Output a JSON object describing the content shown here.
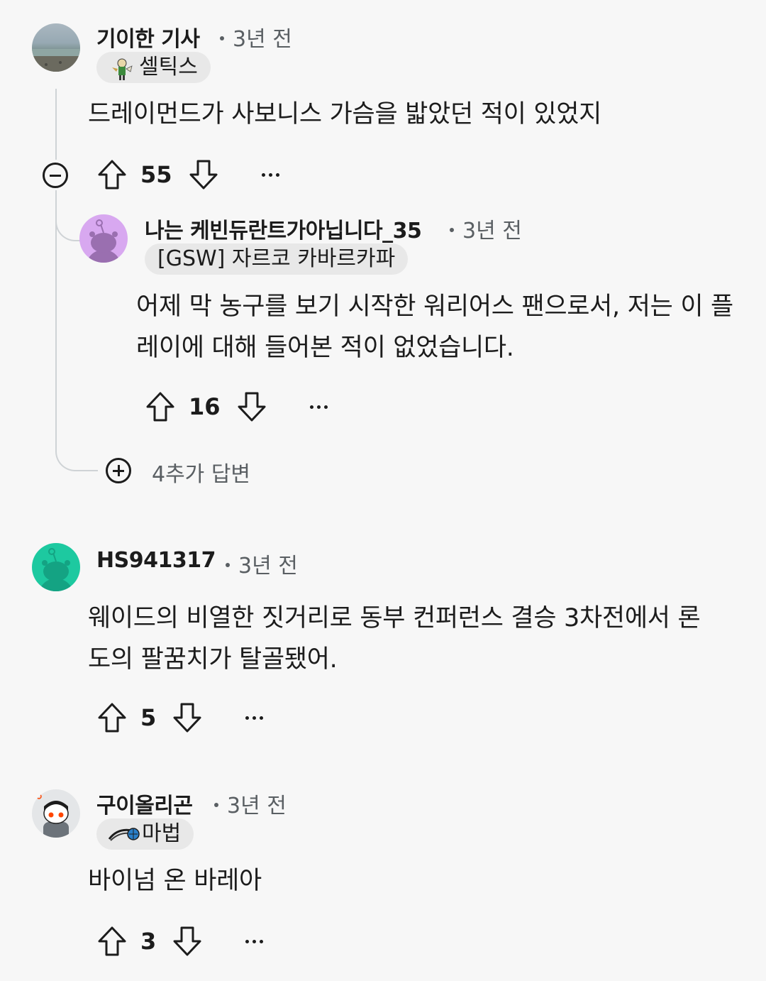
{
  "comments": [
    {
      "username": "기이한 기사",
      "time": "3년 전",
      "flair": "셀틱스",
      "body": "드레이먼드가 사보니스 가슴을 밟았던 적이 있었지",
      "votes": "55"
    },
    {
      "username": "나는 케빈듀란트가아닙니다_35",
      "time": "3년 전",
      "flair": "[GSW] 자르코 카바르카파",
      "body": "어제 막 농구를 보기 시작한 워리어스 팬으로서, 저는 이 플레이에 대해 들어본 적이 없었습니다.",
      "votes": "16"
    },
    {
      "username": "HS941317",
      "time": "3년 전",
      "body": "웨이드의 비열한 짓거리로 동부 컨퍼런스 결승 3차전에서 론도의 팔꿈치가 탈골됐어.",
      "votes": "5"
    },
    {
      "username": "구이올리곤",
      "time": "3년 전",
      "flair": "마법",
      "body": "바이넘 온 바레아",
      "votes": "3"
    }
  ],
  "more_replies": "4추가 답변",
  "colors": {
    "background": "#f7f7f7",
    "text": "#1c1c1c",
    "meta": "#5a5f63",
    "flair_bg": "#e8e8e8",
    "thread_line": "#cfd3d6",
    "avatar_purple": "#d8a8f0",
    "avatar_teal": "#1dc9a0"
  }
}
